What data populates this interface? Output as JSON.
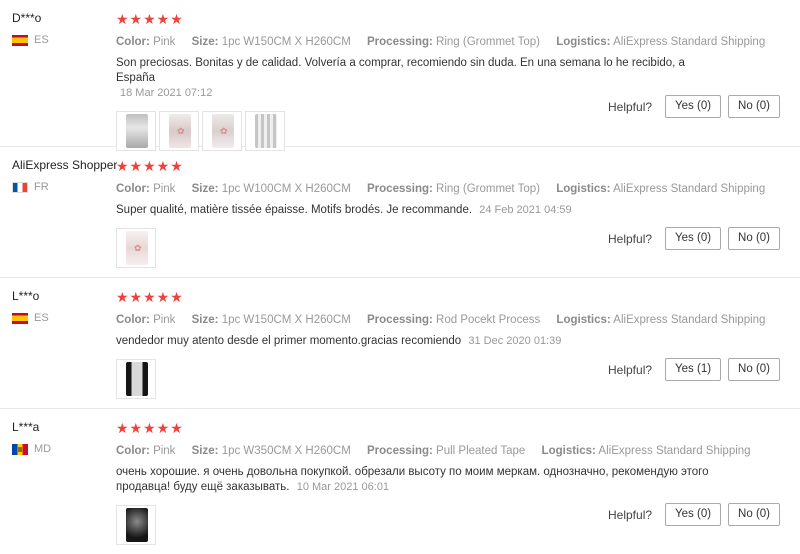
{
  "labels": {
    "color": "Color:",
    "size": "Size:",
    "processing": "Processing:",
    "logistics": "Logistics:",
    "helpful": "Helpful?"
  },
  "stars": "★★★★★",
  "reviews": [
    {
      "user": "D***o",
      "country": "ES",
      "flag_icon": "spain-flag-icon",
      "rating": 5,
      "color": "Pink",
      "size": "1pc W150CM X H260CM",
      "processing": "Ring (Grommet Top)",
      "logistics": "AliExpress Standard Shipping",
      "text": "Son preciosas. Bonitas y de calidad. Volvería a comprar, recomiendo sin duda. En una semana lo he recibido, a España",
      "date": "18 Mar 2021 07:12",
      "yes": "Yes (0)",
      "no": "No (0)"
    },
    {
      "user": "AliExpress Shopper",
      "country": "FR",
      "flag_icon": "france-flag-icon",
      "rating": 5,
      "color": "Pink",
      "size": "1pc W100CM X H260CM",
      "processing": "Ring (Grommet Top)",
      "logistics": "AliExpress Standard Shipping",
      "text": "Super qualité, matière tissée épaisse. Motifs brodés. Je recommande.",
      "date": "24 Feb 2021 04:59",
      "yes": "Yes (0)",
      "no": "No (0)"
    },
    {
      "user": "L***o",
      "country": "ES",
      "flag_icon": "spain-flag-icon",
      "rating": 5,
      "color": "Pink",
      "size": "1pc W150CM X H260CM",
      "processing": "Rod Pocekt Process",
      "logistics": "AliExpress Standard Shipping",
      "text": "vendedor muy atento desde el primer momento.gracias recomiendo",
      "date": "31 Dec 2020 01:39",
      "yes": "Yes (1)",
      "no": "No (0)"
    },
    {
      "user": "L***a",
      "country": "MD",
      "flag_icon": "moldova-flag-icon",
      "rating": 5,
      "color": "Pink",
      "size": "1pc W350CM X H260CM",
      "processing": "Pull Pleated Tape",
      "logistics": "AliExpress Standard Shipping",
      "text": "очень хорошие. я очень довольна покупкой. обрезали высоту по моим меркам. однозначно, рекомендую этого продавца! буду ещё заказывать.",
      "date": "10 Mar 2021 06:01",
      "yes": "Yes (0)",
      "no": "No (0)"
    }
  ]
}
